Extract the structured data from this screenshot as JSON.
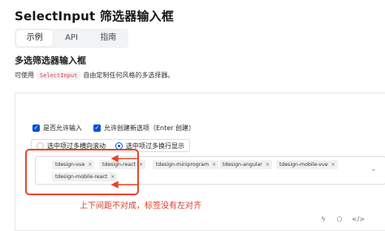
{
  "page": {
    "title": "SelectInput 筛选器输入框",
    "tabs": [
      {
        "label": "示例",
        "active": true
      },
      {
        "label": "API",
        "active": false
      },
      {
        "label": "指南",
        "active": false
      }
    ],
    "section_title": "多选筛选器输入框",
    "description": {
      "prefix": "可使用",
      "code": "SelectInput",
      "suffix": "自由定制任何风格的多选择器。"
    }
  },
  "demo": {
    "checkbox_allow_input": {
      "label": "是否允许输入",
      "checked": true
    },
    "checkbox_create_option": {
      "label": "允许创建新选项（Enter 创建）",
      "checked": true
    },
    "radio_options": [
      {
        "label": "选中项过多横向滚动",
        "selected": false
      },
      {
        "label": "选中项过多换行显示",
        "selected": true
      }
    ],
    "tags": [
      "tdesign-vue",
      "tdesign-react",
      "tdesign-miniprogram",
      "tdesign-angular",
      "tdesign-mobile-vue",
      "tdesign-mobile-react"
    ],
    "tag_close_icon": "×",
    "dropdown_icon": "chevron-down-icon"
  },
  "annotation": {
    "text": "上下间距不对成，标签没有左对齐",
    "color": "#e8452c"
  },
  "colors": {
    "primary": "#0052d9",
    "code_text": "#d64040"
  },
  "toolbar_icons": [
    "lightning-icon",
    "cube-icon",
    "code-icon"
  ]
}
